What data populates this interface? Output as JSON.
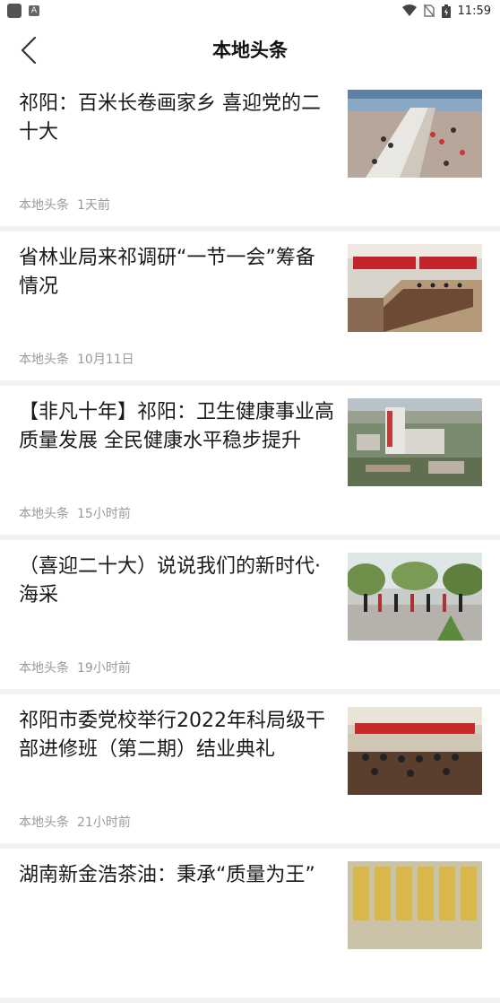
{
  "status_bar": {
    "time": "11:59"
  },
  "header": {
    "title": "本地头条"
  },
  "articles": [
    {
      "title": "祁阳：百米长卷画家乡 喜迎党的二十大",
      "source": "本地头条",
      "time": "1天前",
      "thumb_icon": "photo-square-painting"
    },
    {
      "title": "省林业局来祁调研“一节一会”筹备情况",
      "source": "本地头条",
      "time": "10月11日",
      "thumb_icon": "photo-meeting-room"
    },
    {
      "title": "【非凡十年】祁阳：卫生健康事业高质量发展 全民健康水平稳步提升",
      "source": "本地头条",
      "time": "15小时前",
      "thumb_icon": "photo-hospital-aerial"
    },
    {
      "title": "（喜迎二十大）说说我们的新时代·海采",
      "source": "本地头条",
      "time": "19小时前",
      "thumb_icon": "photo-square-dance"
    },
    {
      "title": "祁阳市委党校举行2022年科局级干部进修班（第二期）结业典礼",
      "source": "本地头条",
      "time": "21小时前",
      "thumb_icon": "photo-ceremony-hall"
    },
    {
      "title": "湖南新金浩茶油：秉承“质量为王”",
      "source": "",
      "time": "",
      "thumb_icon": "photo-oil-bottles"
    }
  ]
}
